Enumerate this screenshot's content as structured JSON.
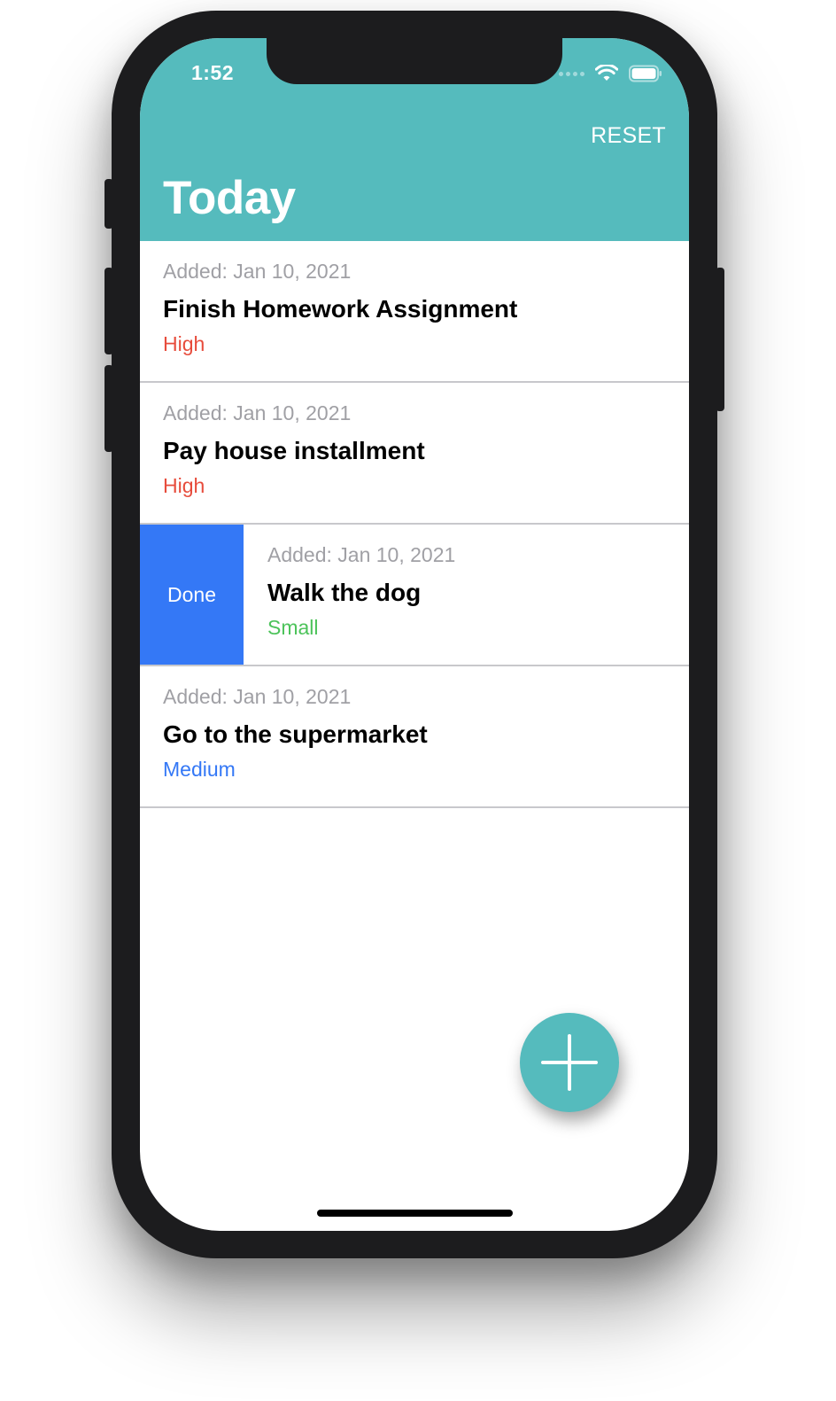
{
  "status_bar": {
    "time": "1:52"
  },
  "header": {
    "reset_label": "RESET",
    "title": "Today",
    "color": "#55bbbd"
  },
  "tasks": [
    {
      "added": "Added: Jan 10, 2021",
      "title": "Finish Homework Assignment",
      "priority": "High",
      "priority_color": "#e74c3c"
    },
    {
      "added": "Added: Jan 10, 2021",
      "title": "Pay house installment",
      "priority": "High",
      "priority_color": "#e74c3c"
    },
    {
      "added": "Added: Jan 10, 2021",
      "title": "Walk the dog",
      "priority": "Small",
      "priority_color": "#4cc35a",
      "swipe_action": "Done"
    },
    {
      "added": "Added: Jan 10, 2021",
      "title": "Go to the supermarket",
      "priority": "Medium",
      "priority_color": "#3478f6"
    }
  ],
  "colors": {
    "done_action": "#3478f6",
    "fab": "#55bbbd"
  },
  "icons": {
    "fab": "plus-icon",
    "wifi": "wifi-icon",
    "battery": "battery-icon"
  }
}
